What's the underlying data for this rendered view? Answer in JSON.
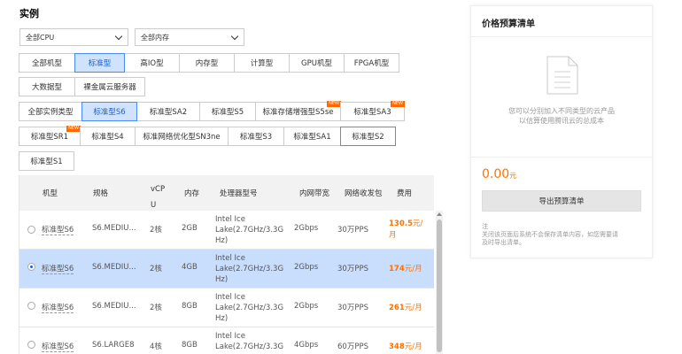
{
  "section_title": "实例",
  "filters": {
    "cpu_select": "全部CPU",
    "memory_select": "全部内存"
  },
  "category_tabs_row1": [
    "全部机型",
    "标准型",
    "高IO型",
    "内存型",
    "计算型",
    "GPU机型",
    "FPGA机型"
  ],
  "category_tabs_row2": [
    "大数据型",
    "裸金属云服务器"
  ],
  "instance_tabs_row1": [
    "全部实例类型",
    "标准型S6",
    "标准型SA2",
    "标准型S5",
    "标准存储增强型S5se",
    "标准型SA3"
  ],
  "instance_tabs_row2": [
    "标准型SR1",
    "标准型S4",
    "标准网络优化型SN3ne",
    "标准型S3",
    "标准型SA1",
    "标准型S2"
  ],
  "instance_tabs_row3": [
    "标准型S1"
  ],
  "new_badge": "NEW",
  "table": {
    "headers": {
      "model": "机型",
      "spec": "规格",
      "vcpu_line1": "vCP",
      "vcpu_line2": "U",
      "memory": "内存",
      "cpu_model": "处理器型号",
      "bandwidth": "内网带宽",
      "pps": "网络收发包",
      "price": "费用"
    },
    "rows": [
      {
        "model": "标准型S6",
        "spec": "S6.MEDIU...",
        "vcpu": "2核",
        "memory": "2GB",
        "cpu_line1": "Intel Ice",
        "cpu_line2": "Lake(2.7GHz/3.3G",
        "cpu_line3": "Hz)",
        "bandwidth": "2Gbps",
        "pps": "30万PPS",
        "price": "130.5",
        "price_unit1": "元/",
        "price_unit2": "月",
        "selected": false
      },
      {
        "model": "标准型S6",
        "spec": "S6.MEDIU...",
        "vcpu": "2核",
        "memory": "4GB",
        "cpu_line1": "Intel Ice",
        "cpu_line2": "Lake(2.7GHz/3.3G",
        "cpu_line3": "Hz)",
        "bandwidth": "2Gbps",
        "pps": "30万PPS",
        "price": "174",
        "price_unit1": "元/月",
        "price_unit2": "",
        "selected": true
      },
      {
        "model": "标准型S6",
        "spec": "S6.MEDIU...",
        "vcpu": "2核",
        "memory": "8GB",
        "cpu_line1": "Intel Ice",
        "cpu_line2": "Lake(2.7GHz/3.3G",
        "cpu_line3": "Hz)",
        "bandwidth": "2Gbps",
        "pps": "30万PPS",
        "price": "261",
        "price_unit1": "元/月",
        "price_unit2": "",
        "selected": false
      },
      {
        "model": "标准型S6",
        "spec": "S6.LARGE8",
        "vcpu": "4核",
        "memory": "8GB",
        "cpu_line1": "Intel Ice",
        "cpu_line2": "Lake(2.7GHz/3.3G",
        "cpu_line3": "",
        "bandwidth": "4Gbps",
        "pps": "60万PPS",
        "price": "348",
        "price_unit1": "元/月",
        "price_unit2": "",
        "selected": false
      }
    ]
  },
  "panel": {
    "title": "价格预算清单",
    "empty_line1": "您可以分别加入不同类型的云产品",
    "empty_line2": "以估算使用腾讯云的总成本",
    "total": "0.00",
    "total_unit": "元",
    "export_label": "导出预算清单",
    "note_line1": "注",
    "note_line2": "关闭该页面后系统不会保存清单内容，如您需要请",
    "note_line3": "及时导出清单。"
  },
  "colors": {
    "accent": "#1a5fd6",
    "price": "#ff7200",
    "selected_bg": "#c9ddfc",
    "badge": "#ff6a00"
  }
}
